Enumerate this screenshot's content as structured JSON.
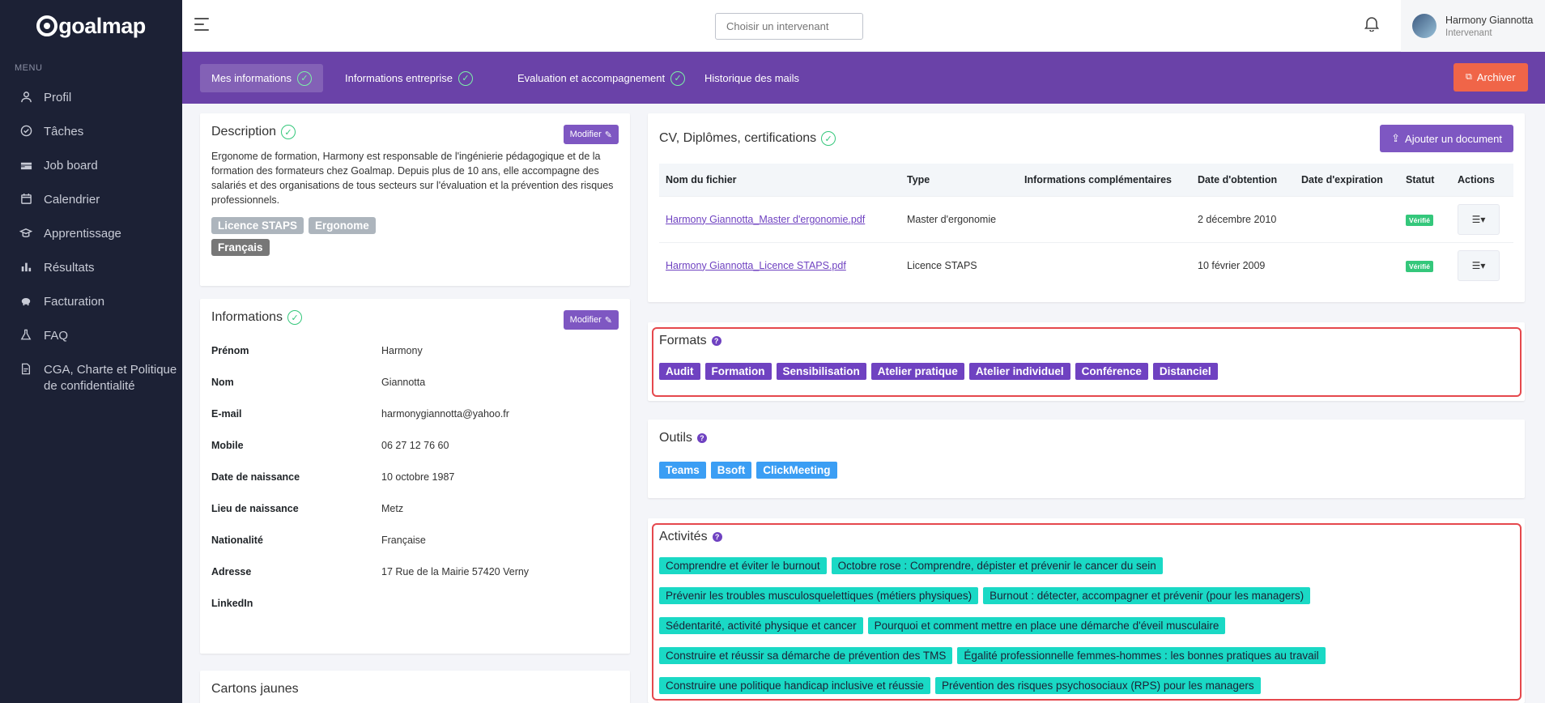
{
  "brand": {
    "name": "goalmap"
  },
  "sidebar": {
    "menu_title": "MENU",
    "items": [
      {
        "label": "Profil",
        "icon": "user-icon"
      },
      {
        "label": "Tâches",
        "icon": "check-circle-icon"
      },
      {
        "label": "Job board",
        "icon": "briefcase-icon"
      },
      {
        "label": "Calendrier",
        "icon": "calendar-icon"
      },
      {
        "label": "Apprentissage",
        "icon": "graduation-icon"
      },
      {
        "label": "Résultats",
        "icon": "bar-chart-icon"
      },
      {
        "label": "Facturation",
        "icon": "piggy-bank-icon"
      },
      {
        "label": "FAQ",
        "icon": "flask-icon"
      },
      {
        "label": "CGA, Charte et Politique de confidentialité",
        "icon": "document-icon"
      }
    ]
  },
  "topbar": {
    "search_placeholder": "Choisir un intervenant",
    "user": {
      "name": "Harmony Giannotta",
      "role": "Intervenant"
    }
  },
  "tabs": [
    {
      "label": "Mes informations",
      "checked": true,
      "active": true
    },
    {
      "label": "Informations entreprise",
      "checked": true,
      "active": false
    },
    {
      "label": "Evaluation et accompagnement",
      "checked": true,
      "active": false
    },
    {
      "label": "Historique des mails",
      "checked": false,
      "active": false
    }
  ],
  "archive_label": "Archiver",
  "description": {
    "title": "Description",
    "modify_label": "Modifier",
    "text": "Ergonome de formation, Harmony est responsable de l'ingénierie pédagogique et de la formation des formateurs chez Goalmap. Depuis plus de 10 ans, elle accompagne des salariés et des organisations de tous secteurs sur l'évaluation et la prévention des risques professionnels.",
    "badges": [
      "Licence STAPS",
      "Ergonome"
    ],
    "language_badge": "Français"
  },
  "informations": {
    "title": "Informations",
    "modify_label": "Modifier",
    "rows": [
      {
        "label": "Prénom",
        "value": "Harmony"
      },
      {
        "label": "Nom",
        "value": "Giannotta"
      },
      {
        "label": "E-mail",
        "value": "harmonygiannotta@yahoo.fr"
      },
      {
        "label": "Mobile",
        "value": "06 27 12 76 60"
      },
      {
        "label": "Date de naissance",
        "value": "10 octobre 1987"
      },
      {
        "label": "Lieu de naissance",
        "value": "Metz"
      },
      {
        "label": "Nationalité",
        "value": "Française"
      },
      {
        "label": "Adresse",
        "value": "17 Rue de la Mairie 57420 Verny"
      },
      {
        "label": "LinkedIn",
        "value": ""
      }
    ]
  },
  "cartons": {
    "title": "Cartons jaunes"
  },
  "cv": {
    "title": "CV, Diplômes, certifications",
    "add_label": "Ajouter un document",
    "columns": [
      "Nom du fichier",
      "Type",
      "Informations complémentaires",
      "Date d'obtention",
      "Date d'expiration",
      "Statut",
      "Actions"
    ],
    "rows": [
      {
        "file": "Harmony Giannotta_Master d'ergonomie.pdf",
        "type": "Master d'ergonomie",
        "info": "",
        "obtained": "2 décembre 2010",
        "expires": "",
        "status": "Vérifié"
      },
      {
        "file": "Harmony Giannotta_Licence STAPS.pdf",
        "type": "Licence STAPS",
        "info": "",
        "obtained": "10 février 2009",
        "expires": "",
        "status": "Vérifié"
      }
    ]
  },
  "formats": {
    "title": "Formats",
    "items": [
      "Audit",
      "Formation",
      "Sensibilisation",
      "Atelier pratique",
      "Atelier individuel",
      "Conférence",
      "Distanciel"
    ]
  },
  "outils": {
    "title": "Outils",
    "items": [
      "Teams",
      "Bsoft",
      "ClickMeeting"
    ]
  },
  "activites": {
    "title": "Activités",
    "rows": [
      [
        "Comprendre et éviter le burnout",
        "Octobre rose : Comprendre, dépister et prévenir le cancer du sein"
      ],
      [
        "Prévenir les troubles musculosquelettiques (métiers physiques)",
        "Burnout : détecter, accompagner et prévenir (pour les managers)"
      ],
      [
        "Sédentarité, activité physique et cancer",
        "Pourquoi et comment mettre en place une démarche d'éveil musculaire"
      ],
      [
        "Construire et réussir sa démarche de prévention des TMS",
        "Égalité professionnelle femmes-hommes : les bonnes pratiques au travail"
      ],
      [
        "Construire une politique handicap inclusive et réussie",
        "Prévention des risques psychosociaux (RPS) pour les managers"
      ]
    ]
  },
  "colors": {
    "sidebar": "#1c2135",
    "tabbar": "#6a42a8",
    "accent": "#6f42c1",
    "teal": "#1ad9c5",
    "archive": "#f06548",
    "highlight": "#e5484d"
  }
}
